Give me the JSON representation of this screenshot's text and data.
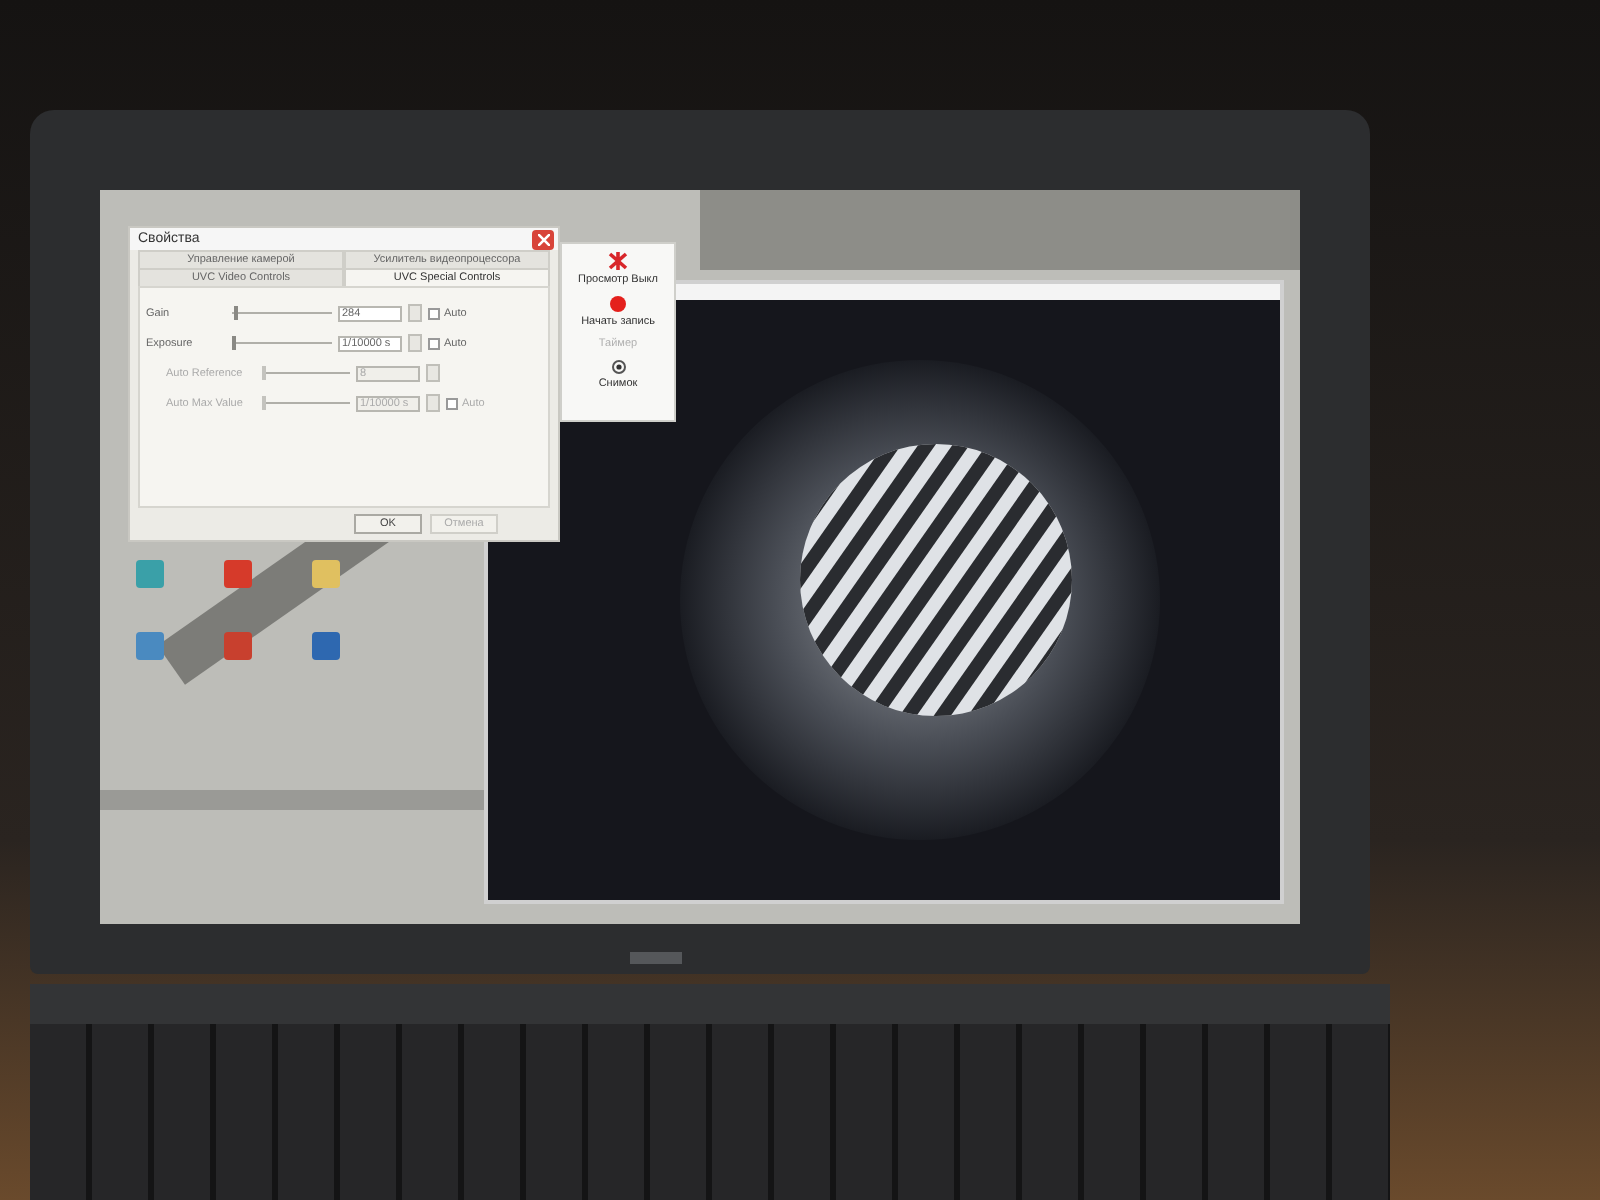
{
  "properties_dialog": {
    "title": "Свойства",
    "tab_rows": [
      [
        {
          "label": "Управление камерой",
          "selected": false
        },
        {
          "label": "Усилитель видеопроцессора",
          "selected": false
        }
      ],
      [
        {
          "label": "UVC Video Controls",
          "selected": false
        },
        {
          "label": "UVC Special Controls",
          "selected": true
        }
      ]
    ],
    "controls": [
      {
        "label": "Gain",
        "level": 0.02,
        "value": "284",
        "auto_label": "Auto",
        "checked": false,
        "disabled": false
      },
      {
        "label": "Exposure",
        "level": 0.0,
        "value": "1/10000 s",
        "auto_label": "Auto",
        "checked": false,
        "disabled": false
      },
      {
        "label": "Auto Reference",
        "level": 0.0,
        "value": "8",
        "disabled": true
      },
      {
        "label": "Auto Max Value",
        "level": 0.0,
        "value": "1/10000 s",
        "auto_label": "Auto",
        "checked": false,
        "disabled": true
      }
    ],
    "buttons": [
      {
        "label": "OK",
        "disabled": false
      },
      {
        "label": "Отмена",
        "disabled": true
      }
    ]
  },
  "capture_panel": {
    "buttons": [
      {
        "kind": "cross",
        "label": "Просмотр Выкл",
        "disabled": false
      },
      {
        "kind": "record",
        "label": "Начать запись",
        "disabled": false
      },
      {
        "kind": "none",
        "label": "Таймер",
        "disabled": true
      },
      {
        "kind": "snapshot",
        "label": "Снимок",
        "disabled": false
      }
    ]
  }
}
